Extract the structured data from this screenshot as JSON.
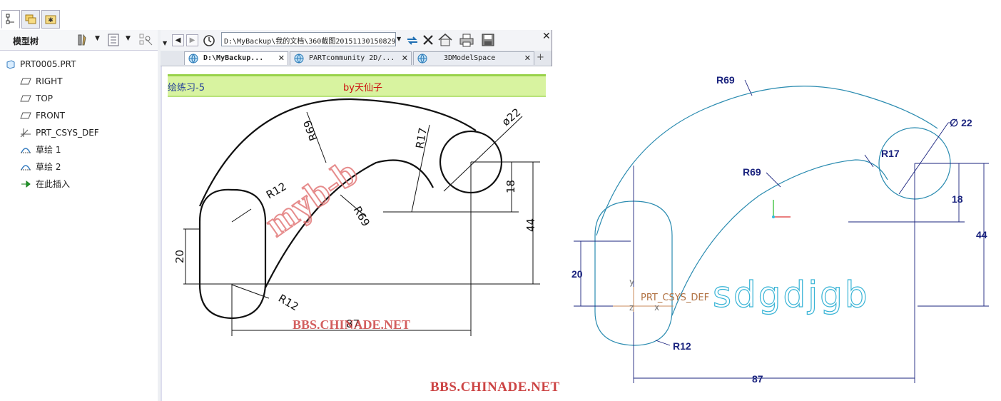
{
  "top_tabs": [
    {
      "name": "model-tree-tab",
      "icon": "tree-icon"
    },
    {
      "name": "folder-browser-tab",
      "icon": "folders-icon"
    },
    {
      "name": "favorites-tab",
      "icon": "star-icon"
    }
  ],
  "model_tree": {
    "title": "模型树",
    "items": [
      {
        "label": "PRT0005.PRT",
        "icon": "part-icon"
      },
      {
        "label": "RIGHT",
        "icon": "datum-plane-icon"
      },
      {
        "label": "TOP",
        "icon": "datum-plane-icon"
      },
      {
        "label": "FRONT",
        "icon": "datum-plane-icon"
      },
      {
        "label": "PRT_CSYS_DEF",
        "icon": "csys-icon"
      },
      {
        "label": "草绘 1",
        "icon": "sketch-icon"
      },
      {
        "label": "草绘 2",
        "icon": "sketch-icon"
      },
      {
        "label": "在此插入",
        "icon": "insert-arrow-icon"
      }
    ]
  },
  "browser": {
    "address": "D:\\MyBackup\\我的文档\\360截图20151130150829",
    "tabs": [
      {
        "label": "D:\\MyBackup...",
        "active": true
      },
      {
        "label": "PARTcommunity 2D/...",
        "active": false
      },
      {
        "label": "3DModelSpace",
        "active": false
      }
    ],
    "banner_left": "绘练习-5",
    "banner_right": "by天仙子",
    "drawing_labels": {
      "dia": "ø22",
      "r17": "R17",
      "r69_outer": "R69",
      "r69_inner": "R69",
      "r12_top": "R12",
      "r12_bottom": "R12",
      "d20": "20",
      "d18": "18",
      "d44": "44",
      "d87": "87"
    },
    "stamp": "myb-b",
    "watermark": "BBS.CHINADE.NET"
  },
  "cad": {
    "labels": {
      "r69_outer": "R69",
      "dia": "∅ 22",
      "r17": "R17",
      "r69_inner": "R69",
      "d18": "18",
      "d44": "44",
      "d20": "20",
      "r12": "R12",
      "d87": "87",
      "csys": "PRT_CSYS_DEF",
      "axis_y": "y",
      "axis_x": "x",
      "axis_z": "z"
    },
    "text_3d": "sdgdjgb"
  },
  "watermark_bottom": "BBS.CHINADE.NET",
  "colors": {
    "sketch": "#2a8bb0",
    "dimension": "#1a237e",
    "cad_text": "#39b4d6",
    "watermark": "#cc4444"
  }
}
